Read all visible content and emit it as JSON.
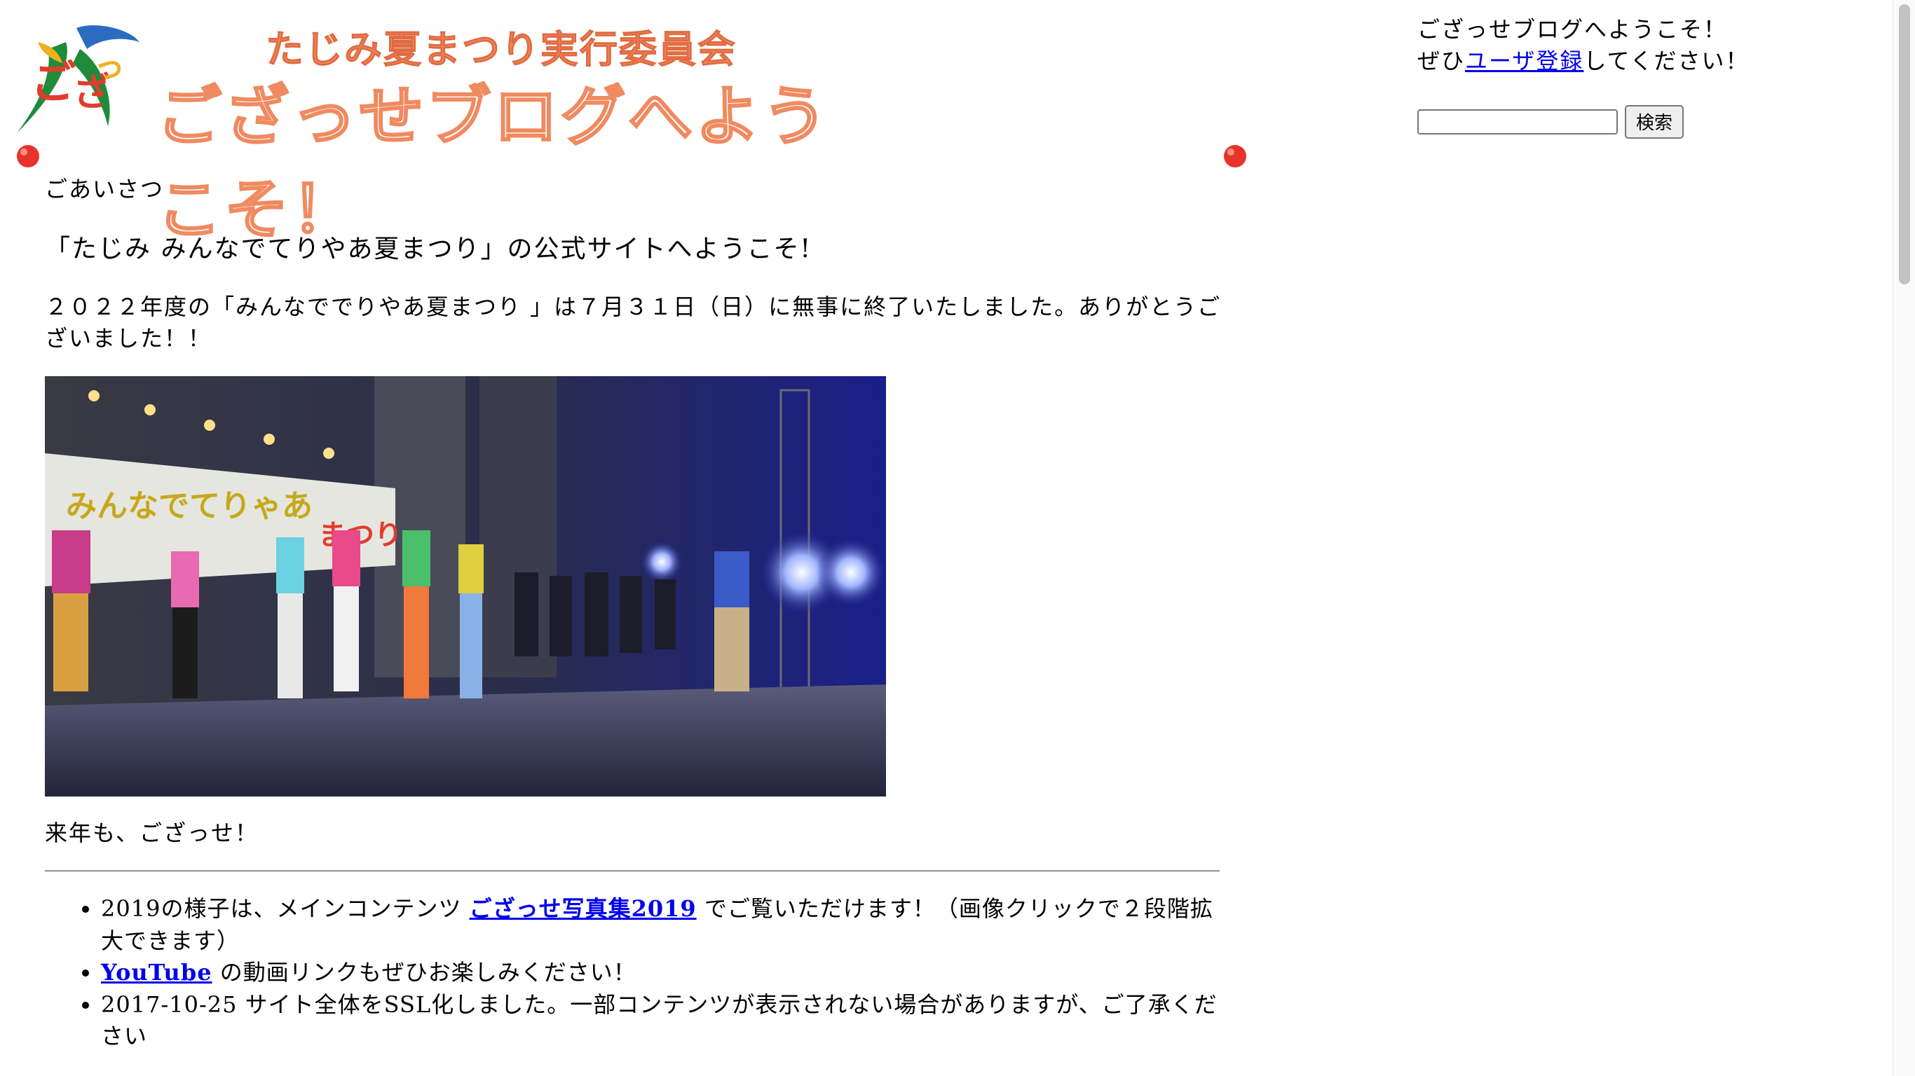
{
  "banner": {
    "org_name": "たじみ夏まつり実行委員会",
    "welcome": "ござっせブログへようこそ！",
    "logo_icon": "festival-logo-icon",
    "logo_colors": [
      "#e23c2c",
      "#1e8c3a",
      "#f0b020",
      "#2c6cc0"
    ],
    "accent_color": "#f08a60"
  },
  "main": {
    "greeting_title": "ごあいさつ",
    "heading": "「たじみ みんなでてりやあ夏まつり」の公式サイトへようこそ!",
    "intro": "２０２２年度の「みんなででりやあ夏まつり 」は７月３１日（日）に無事に終了いたしました。ありがとうございました！！",
    "photo_description_icon": "stage-photo",
    "next_year": "来年も、ござっせ！",
    "news": [
      {
        "prefix": "2019の様子は、メインコンテンツ ",
        "link": "ござっせ写真集2019",
        "suffix": " でご覧いただけます！（画像クリックで２段階拡大できます）"
      },
      {
        "prefix": "",
        "link": "YouTube",
        "suffix": " の動画リンクもぜひお楽しみください！"
      },
      {
        "prefix": "2017-10-25 サイト全体をSSL化しました。一部コンテンツが表示されない場合がありますが、ご了承ください",
        "link": "",
        "suffix": ""
      }
    ]
  },
  "sidebar": {
    "welcome": "ござっせブログへようこそ！",
    "register_prefix": "ぜひ",
    "register_link": "ユーザ登録",
    "register_suffix": "してください！",
    "search_placeholder": "",
    "search_button": "検索"
  },
  "colors": {
    "link": "#0000ee",
    "deco_ball": "#e8322c"
  }
}
